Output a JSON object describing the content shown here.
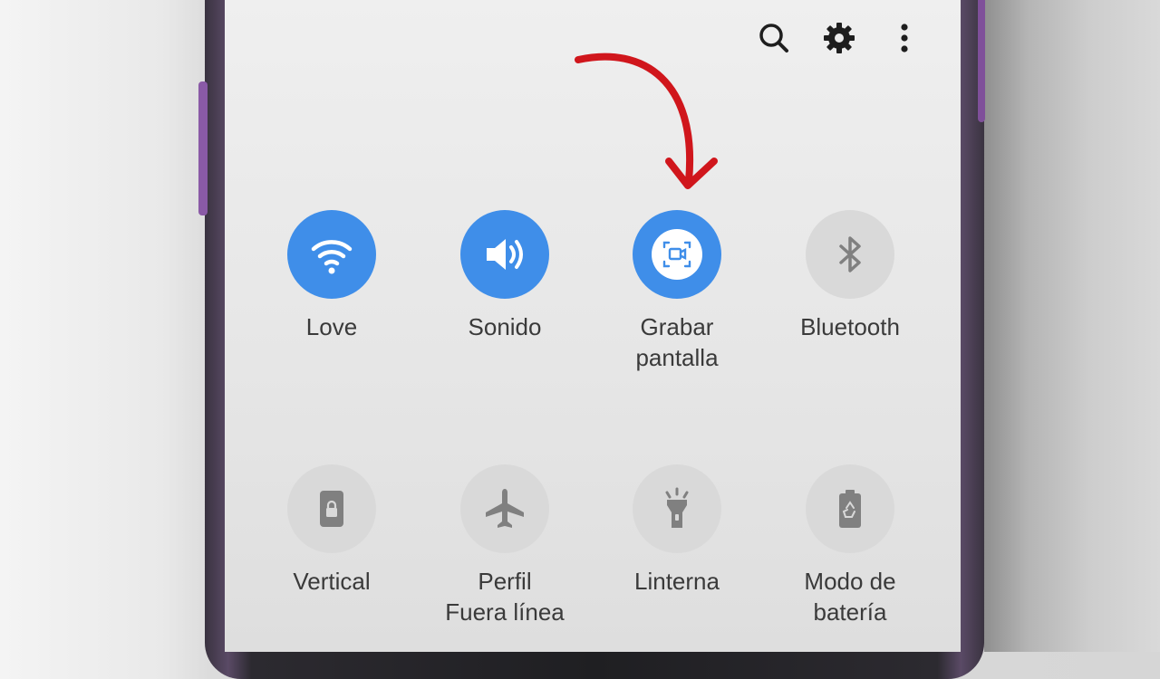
{
  "header": {
    "icons": [
      "search-icon",
      "gear-icon",
      "more-vertical-icon"
    ]
  },
  "tiles": [
    {
      "label_lines": [
        "Love"
      ],
      "active": true,
      "icon": "wifi-icon"
    },
    {
      "label_lines": [
        "Sonido"
      ],
      "active": true,
      "icon": "volume-icon"
    },
    {
      "label_lines": [
        "Grabar",
        "pantalla"
      ],
      "active": true,
      "icon": "screen-record-icon"
    },
    {
      "label_lines": [
        "Bluetooth"
      ],
      "active": false,
      "icon": "bluetooth-icon"
    },
    {
      "label_lines": [
        "Vertical"
      ],
      "active": false,
      "icon": "portrait-lock-icon"
    },
    {
      "label_lines": [
        "Perfil",
        "Fuera línea"
      ],
      "active": false,
      "icon": "airplane-icon"
    },
    {
      "label_lines": [
        "Linterna"
      ],
      "active": false,
      "icon": "flashlight-icon"
    },
    {
      "label_lines": [
        "Modo de",
        "batería"
      ],
      "active": false,
      "icon": "battery-saver-icon"
    }
  ],
  "colors": {
    "active": "#3f8ee9",
    "inactive": "#d9d9d9",
    "annotation_arrow": "#d0161c"
  }
}
